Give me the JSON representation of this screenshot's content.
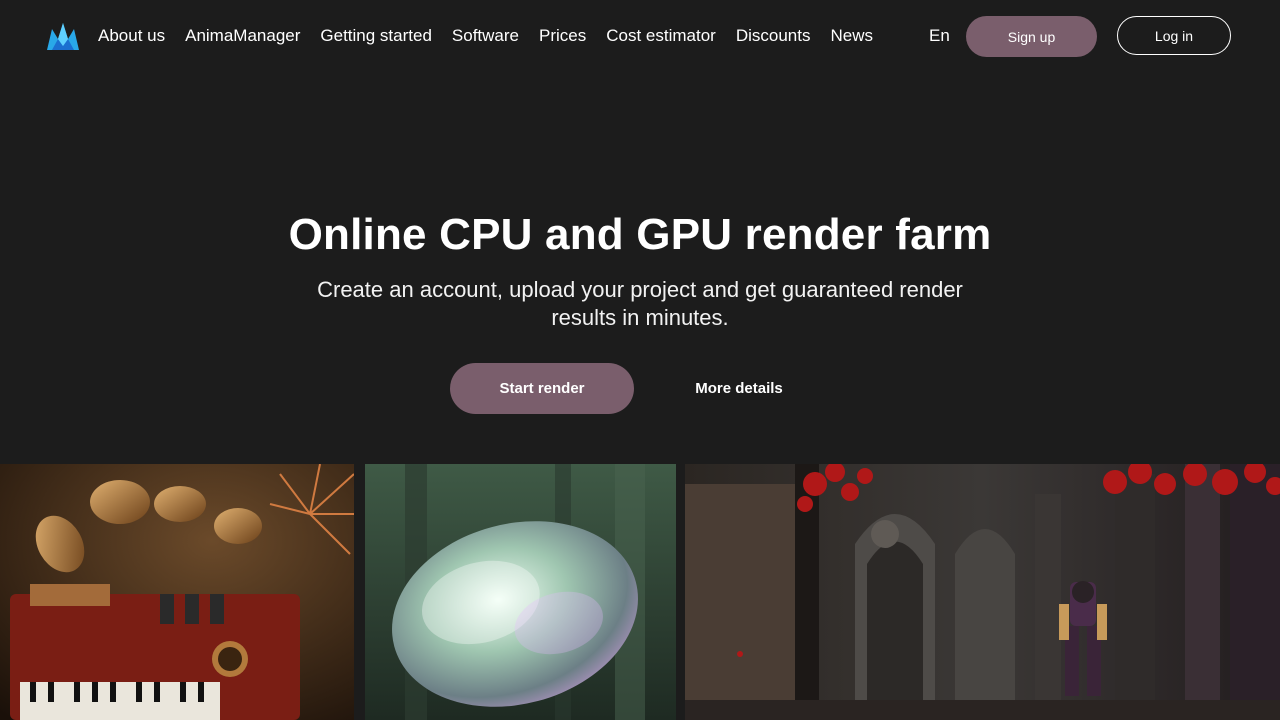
{
  "nav": {
    "logo_icon": "anima-logo-icon",
    "items": [
      {
        "label": "About us"
      },
      {
        "label": "AnimaManager"
      },
      {
        "label": "Getting started"
      },
      {
        "label": "Software"
      },
      {
        "label": "Prices"
      },
      {
        "label": "Cost estimator"
      },
      {
        "label": "Discounts"
      },
      {
        "label": "News"
      }
    ],
    "language": "En",
    "signup_label": "Sign up",
    "login_label": "Log in"
  },
  "hero": {
    "title": "Online CPU and GPU render farm",
    "subtitle": "Create an account, upload your project and get guaranteed render results in minutes.",
    "start_label": "Start render",
    "more_label": "More details"
  },
  "gallery": [
    {
      "subject": "steampunk-organ-gramophone-render"
    },
    {
      "subject": "glass-crystal-in-forest-render"
    },
    {
      "subject": "gothic-cathedral-warrior-render"
    }
  ],
  "colors": {
    "background": "#1c1c1c",
    "accent": "#7a5e6c",
    "logo_blue": "#29a8e8",
    "text": "#ffffff"
  }
}
